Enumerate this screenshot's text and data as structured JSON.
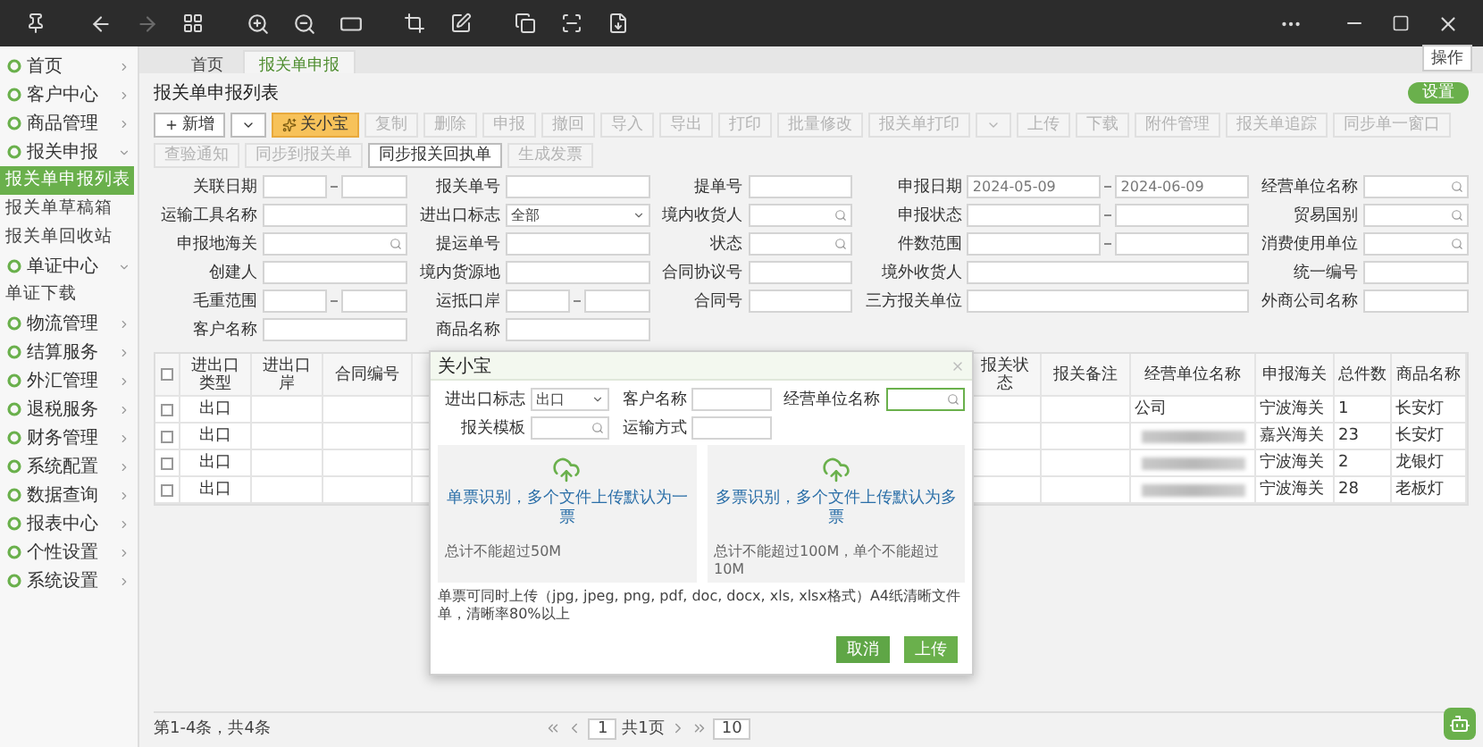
{
  "viewer": {
    "forward_enabled": false
  },
  "sidebar": {
    "items": [
      {
        "label": "首页",
        "expanded": false
      },
      {
        "label": "客户中心",
        "expanded": false
      },
      {
        "label": "商品管理",
        "expanded": false
      },
      {
        "label": "报关申报",
        "expanded": true,
        "children": [
          {
            "label": "报关单申报列表",
            "selected": true
          },
          {
            "label": "报关单草稿箱",
            "selected": false
          },
          {
            "label": "报关单回收站",
            "selected": false
          }
        ]
      },
      {
        "label": "单证中心",
        "expanded": true,
        "children": [
          {
            "label": "单证下载",
            "selected": false
          }
        ]
      },
      {
        "label": "物流管理",
        "expanded": false
      },
      {
        "label": "结算服务",
        "expanded": false
      },
      {
        "label": "外汇管理",
        "expanded": false
      },
      {
        "label": "退税服务",
        "expanded": false
      },
      {
        "label": "财务管理",
        "expanded": false
      },
      {
        "label": "系统配置",
        "expanded": false
      },
      {
        "label": "数据查询",
        "expanded": false
      },
      {
        "label": "报表中心",
        "expanded": false
      },
      {
        "label": "个性设置",
        "expanded": false
      },
      {
        "label": "系统设置",
        "expanded": false
      }
    ]
  },
  "tabs": [
    {
      "label": "首页",
      "selected": false
    },
    {
      "label": "报关单申报",
      "selected": true
    }
  ],
  "tab_action": "操作",
  "page_title": "报关单申报列表",
  "page_action": "设置",
  "toolbar": [
    {
      "kind": "add",
      "label": "新增",
      "disabled": false
    },
    {
      "kind": "caret",
      "disabled": false
    },
    {
      "kind": "highlight",
      "label": "关小宝",
      "disabled": false
    },
    {
      "kind": "normal",
      "label": "复制",
      "disabled": true
    },
    {
      "kind": "normal",
      "label": "删除",
      "disabled": true
    },
    {
      "kind": "normal",
      "label": "申报",
      "disabled": true
    },
    {
      "kind": "normal",
      "label": "撤回",
      "disabled": true
    },
    {
      "kind": "normal",
      "label": "导入",
      "disabled": true
    },
    {
      "kind": "normal",
      "label": "导出",
      "disabled": true
    },
    {
      "kind": "normal",
      "label": "打印",
      "disabled": true
    },
    {
      "kind": "normal",
      "label": "批量修改",
      "disabled": true
    },
    {
      "kind": "normal",
      "label": "报关单打印",
      "disabled": true
    },
    {
      "kind": "caret",
      "disabled": true
    },
    {
      "kind": "normal",
      "label": "上传",
      "disabled": true
    },
    {
      "kind": "normal",
      "label": "下载",
      "disabled": true
    },
    {
      "kind": "normal",
      "label": "附件管理",
      "disabled": true
    },
    {
      "kind": "normal",
      "label": "报关单追踪",
      "disabled": true
    },
    {
      "kind": "normal",
      "label": "同步单一窗口",
      "disabled": true
    },
    {
      "kind": "normal",
      "label": "查验通知",
      "disabled": true
    },
    {
      "kind": "normal",
      "label": "同步到报关单",
      "disabled": true
    },
    {
      "kind": "normal",
      "label": "同步报关回执单",
      "disabled": false
    },
    {
      "kind": "normal",
      "label": "生成发票",
      "disabled": true
    }
  ],
  "filters": [
    {
      "label": "关联日期",
      "kind": "range"
    },
    {
      "label": "报关单号",
      "kind": "text"
    },
    {
      "label": "提单号",
      "kind": "text"
    },
    {
      "label": "申报日期",
      "kind": "range",
      "values": [
        "2024-05-09",
        "2024-06-09"
      ]
    },
    {
      "label": "经营单位名称",
      "kind": "search"
    },
    {
      "label": "运输工具名称",
      "kind": "text"
    },
    {
      "label": "进出口标志",
      "kind": "select",
      "value": "全部"
    },
    {
      "label": "境内收货人",
      "kind": "search"
    },
    {
      "label": "申报状态",
      "kind": "range"
    },
    {
      "label": "贸易国别",
      "kind": "search"
    },
    {
      "label": "申报地海关",
      "kind": "search"
    },
    {
      "label": "提运单号",
      "kind": "text"
    },
    {
      "label": "状态",
      "kind": "search"
    },
    {
      "label": "件数范围",
      "kind": "range"
    },
    {
      "label": "消费使用单位",
      "kind": "search"
    },
    {
      "label": "创建人",
      "kind": "text"
    },
    {
      "label": "境内货源地",
      "kind": "text"
    },
    {
      "label": "合同协议号",
      "kind": "text"
    },
    {
      "label": "境外收货人",
      "kind": "text"
    },
    {
      "label": "统一编号",
      "kind": "text"
    },
    {
      "label": "毛重范围",
      "kind": "range"
    },
    {
      "label": "运抵口岸",
      "kind": "range"
    },
    {
      "label": "合同号",
      "kind": "text"
    },
    {
      "label": "三方报关单位",
      "kind": "text"
    },
    {
      "label": "外商公司名称",
      "kind": "text"
    },
    {
      "label": "客户名称",
      "kind": "text"
    },
    {
      "label": "商品名称",
      "kind": "text"
    }
  ],
  "table": {
    "all_checked": false,
    "left_columns": [
      "进出口类型",
      "进出口岸",
      "合同编号"
    ],
    "right_columns": [
      "报关状态",
      "报关备注",
      "经营单位名称",
      "申报海关",
      "总件数",
      "商品名称"
    ],
    "rows": [
      {
        "checked": false,
        "type": "出口",
        "company": "公司",
        "company_redacted": false,
        "customs": "宁波海关",
        "count": "1",
        "goods": "长安灯"
      },
      {
        "checked": false,
        "type": "出口",
        "company_redacted": true,
        "customs": "嘉兴海关",
        "count": "23",
        "goods": "长安灯"
      },
      {
        "checked": false,
        "type": "出口",
        "company_redacted": true,
        "customs": "宁波海关",
        "count": "2",
        "goods": "龙银灯"
      },
      {
        "checked": false,
        "type": "出口",
        "company_redacted": true,
        "customs": "宁波海关",
        "count": "28",
        "goods": "老板灯"
      }
    ]
  },
  "footer": {
    "summary": "第1-4条，共4条",
    "page": "1",
    "pages": "共1页",
    "page_size": "10"
  },
  "dialog": {
    "title": "关小宝",
    "fields": [
      {
        "label": "进出口标志",
        "kind": "select",
        "value": "出口",
        "focused": false
      },
      {
        "label": "客户名称",
        "kind": "text",
        "focused": false
      },
      {
        "label": "经营单位名称",
        "kind": "search",
        "focused": true
      },
      {
        "label": "报关模板",
        "kind": "search",
        "focused": false
      },
      {
        "label": "运输方式",
        "kind": "text",
        "focused": false
      }
    ],
    "uploads": [
      {
        "text": "单票识别，多个文件上传默认为一票",
        "note": "总计不能超过50M"
      },
      {
        "text": "多票识别，多个文件上传默认为多票",
        "note": "总计不能超过100M，单个不能超过10M"
      }
    ],
    "hint": "单票可同时上传（jpg, jpeg, png, pdf, doc, docx, xls, xlsx格式）A4纸清晰文件单，清晰率80%以上",
    "buttons": [
      {
        "kind": "cancel",
        "label": "取消"
      },
      {
        "kind": "submit",
        "label": "上传"
      }
    ]
  }
}
